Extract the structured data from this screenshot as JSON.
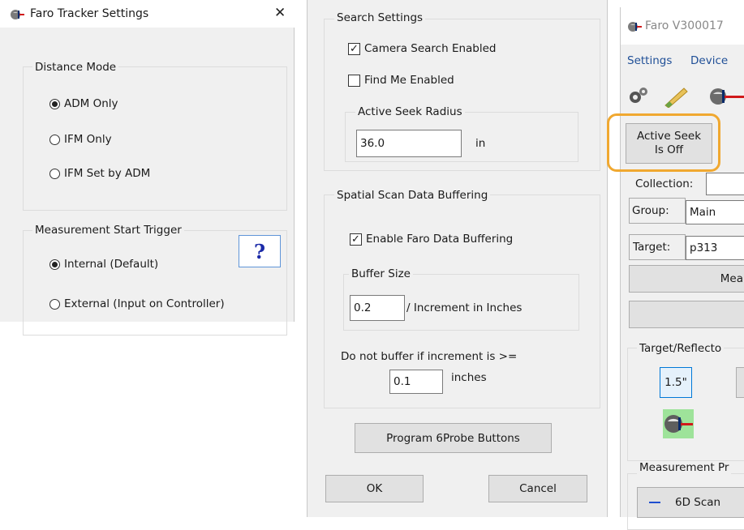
{
  "left_window": {
    "title": "Faro Tracker Settings",
    "close_glyph": "✕",
    "distance_mode": {
      "label": "Distance Mode",
      "options": [
        {
          "label": "ADM Only",
          "selected": true
        },
        {
          "label": "IFM Only",
          "selected": false
        },
        {
          "label": "IFM Set by ADM",
          "selected": false
        }
      ]
    },
    "trigger": {
      "label": "Measurement Start Trigger",
      "options": [
        {
          "label": "Internal (Default)",
          "selected": true
        },
        {
          "label": "External (Input on Controller)",
          "selected": false
        }
      ],
      "help_label": "?"
    }
  },
  "middle_panel": {
    "search_settings": {
      "label": "Search Settings",
      "camera_search": {
        "label": "Camera Search Enabled",
        "checked": true
      },
      "find_me": {
        "label": "Find Me Enabled",
        "checked": false
      },
      "active_seek_radius": {
        "label": "Active Seek Radius",
        "value": "36.0",
        "unit": "in"
      }
    },
    "buffering": {
      "label": "Spatial Scan Data Buffering",
      "enable": {
        "label": "Enable Faro Data Buffering",
        "checked": true
      },
      "buffer_size": {
        "label": "Buffer Size",
        "value": "0.2",
        "unit": "/ Increment in Inches"
      },
      "threshold": {
        "label": "Do not buffer if increment is >=",
        "value": "0.1",
        "unit": "inches"
      }
    },
    "program_button": "Program 6Probe Buttons",
    "ok_button": "OK",
    "cancel_button": "Cancel"
  },
  "right_window": {
    "title": "Faro V300017",
    "menu": [
      "Settings",
      "Device"
    ],
    "active_seek_button": [
      "Active Seek",
      "Is Off"
    ],
    "collection_label": "Collection:",
    "collection_value": "",
    "group_label": "Group:",
    "group_value": "Main",
    "target_label": "Target:",
    "target_value": "p313",
    "measure_button": "Mea",
    "target_section_label": "Target/Reflecto",
    "reflector_size": "1.5\"",
    "measurement_section_label": "Measurement Pr",
    "scan_item": "6D Scan",
    "highlight_color": "#f0a830"
  }
}
